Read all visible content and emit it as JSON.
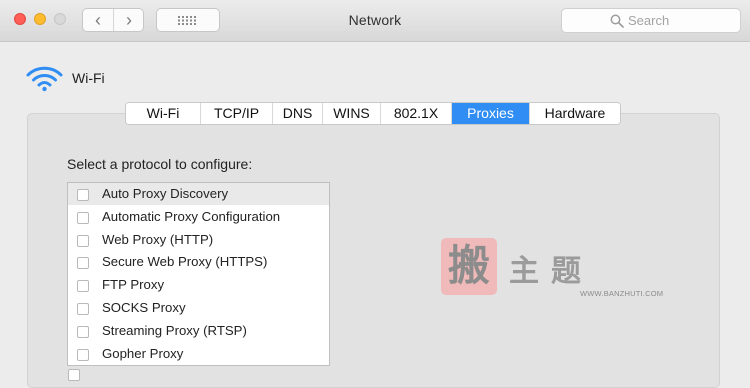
{
  "window": {
    "title": "Network"
  },
  "search": {
    "placeholder": "Search"
  },
  "interface": {
    "name": "Wi-Fi",
    "icon": "wifi-icon"
  },
  "tabs": [
    {
      "label": "Wi-Fi",
      "selected": false
    },
    {
      "label": "TCP/IP",
      "selected": false
    },
    {
      "label": "DNS",
      "selected": false
    },
    {
      "label": "WINS",
      "selected": false
    },
    {
      "label": "802.1X",
      "selected": false
    },
    {
      "label": "Proxies",
      "selected": true
    },
    {
      "label": "Hardware",
      "selected": false
    }
  ],
  "proxies": {
    "prompt": "Select a protocol to configure:",
    "protocols": [
      {
        "label": "Auto Proxy Discovery",
        "checked": false,
        "highlighted": true
      },
      {
        "label": "Automatic Proxy Configuration",
        "checked": false,
        "highlighted": false
      },
      {
        "label": "Web Proxy (HTTP)",
        "checked": false,
        "highlighted": false
      },
      {
        "label": "Secure Web Proxy (HTTPS)",
        "checked": false,
        "highlighted": false
      },
      {
        "label": "FTP Proxy",
        "checked": false,
        "highlighted": false
      },
      {
        "label": "SOCKS Proxy",
        "checked": false,
        "highlighted": false
      },
      {
        "label": "Streaming Proxy (RTSP)",
        "checked": false,
        "highlighted": false
      },
      {
        "label": "Gopher Proxy",
        "checked": false,
        "highlighted": false
      }
    ]
  },
  "watermark": {
    "seal_text": "搬",
    "title": "主题",
    "url": "WWW.BANZHUTI.COM"
  },
  "colors": {
    "accent": "#2f8df3",
    "close": "#ff5f57",
    "minimize": "#febc2e"
  }
}
